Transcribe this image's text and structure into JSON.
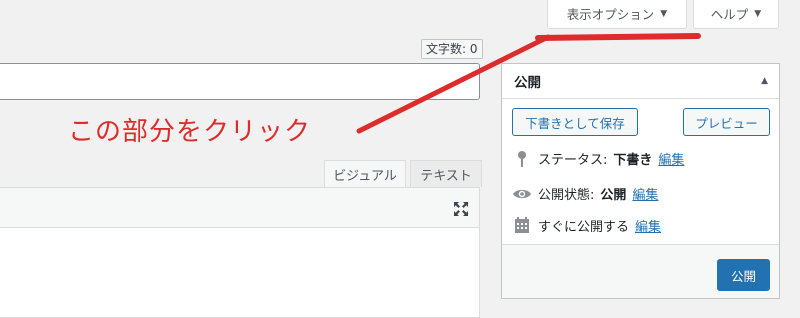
{
  "screen_options": {
    "label": "表示オプション"
  },
  "help": {
    "label": "ヘルプ"
  },
  "editor": {
    "word_count": "文字数: 0",
    "tabs": {
      "visual": "ビジュアル",
      "text": "テキスト"
    }
  },
  "annotation": {
    "text": "この部分をクリック",
    "color": "#dd2c2c"
  },
  "publish": {
    "title": "公開",
    "save_draft": "下書きとして保存",
    "preview": "プレビュー",
    "status_label": "ステータス:",
    "status_value": "下書き",
    "visibility_label": "公開状態:",
    "visibility_value": "公開",
    "schedule_label": "すぐに公開する",
    "edit": "編集",
    "publish_button": "公開"
  },
  "colors": {
    "accent": "#2271b1",
    "background": "#f1f1f1"
  }
}
